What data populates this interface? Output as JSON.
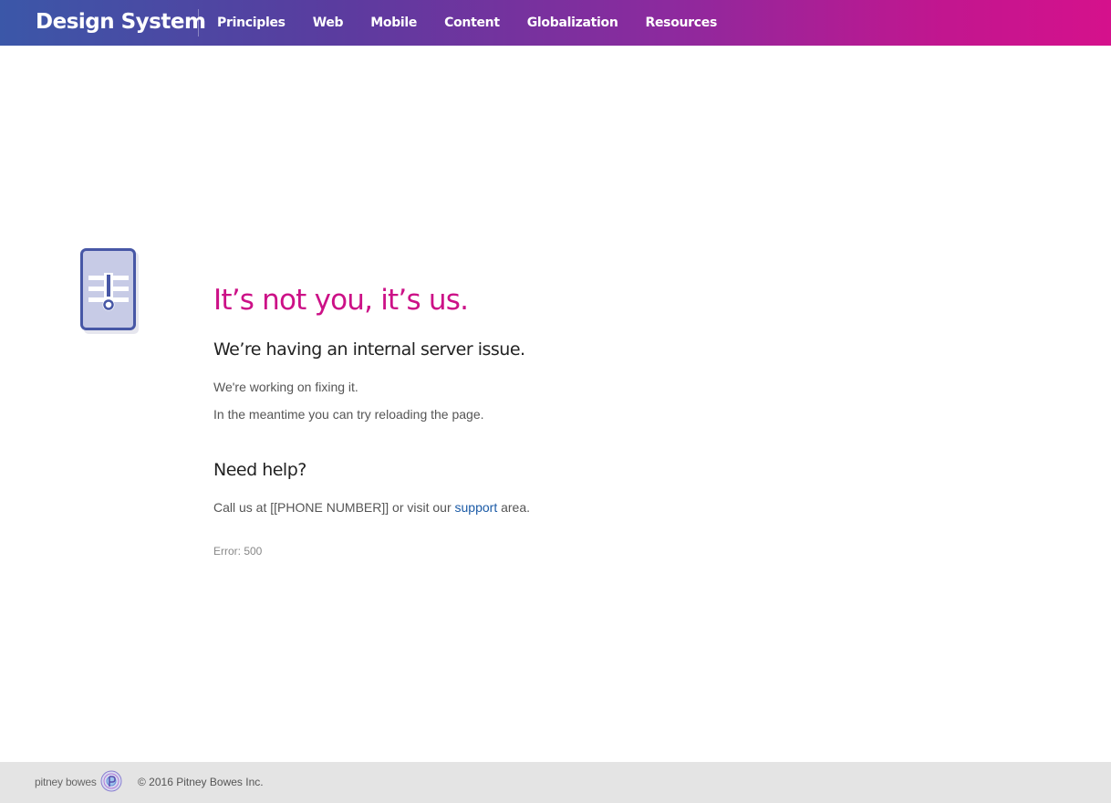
{
  "header": {
    "brand": "Design System",
    "nav": [
      "Principles",
      "Web",
      "Mobile",
      "Content",
      "Globalization",
      "Resources"
    ]
  },
  "main": {
    "icon": "alert-document-icon",
    "headline": "It’s not you, it’s us.",
    "subheading": "We’re having an internal server issue.",
    "paragraphs": [
      "We're working on fixing it.",
      "In the meantime you can try reloading the page."
    ],
    "help": {
      "title": "Need help?",
      "text_before": "Call us at [[PHONE NUMBER]] or visit our ",
      "link": "support",
      "text_after": " area."
    },
    "error_code": "Error: 500"
  },
  "footer": {
    "logo_text": "pitney bowes",
    "copyright": "© 2016 Pitney Bowes Inc."
  },
  "colors": {
    "headline": "#cc1187",
    "link": "#1a5aa6",
    "gradient_start": "#3b57a8",
    "gradient_end": "#d5118c"
  }
}
